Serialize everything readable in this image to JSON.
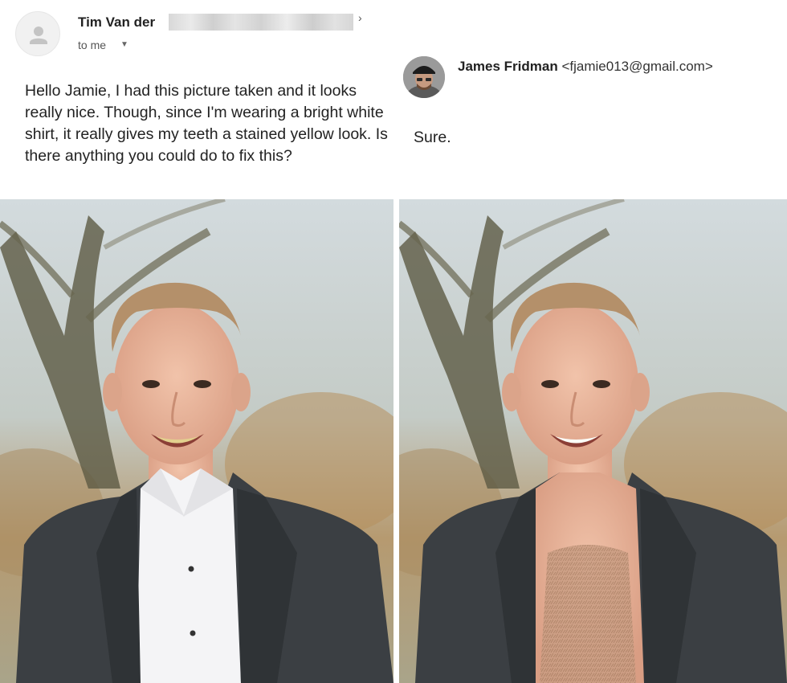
{
  "original_email": {
    "sender_name": "Tim Van der",
    "recipient_label": "to me",
    "caret_icon": "caret-down-icon",
    "body": "Hello Jamie, I had this picture taken and it looks really nice. Though, since I'm wearing a bright white shirt, it really gives my teeth a stained yellow look. Is there anything you could do to fix this?"
  },
  "reply_email": {
    "sender_name": "James Fridman",
    "sender_email": "<fjamie013@gmail.com>",
    "body": "Sure."
  },
  "colors": {
    "jacket": "#3b3f43",
    "shirt": "#f4f4f6",
    "skin": "#e9b59c",
    "chest": "#c89c82",
    "background_sky": "#cfd8dc",
    "background_foliage": "#b9986a"
  }
}
